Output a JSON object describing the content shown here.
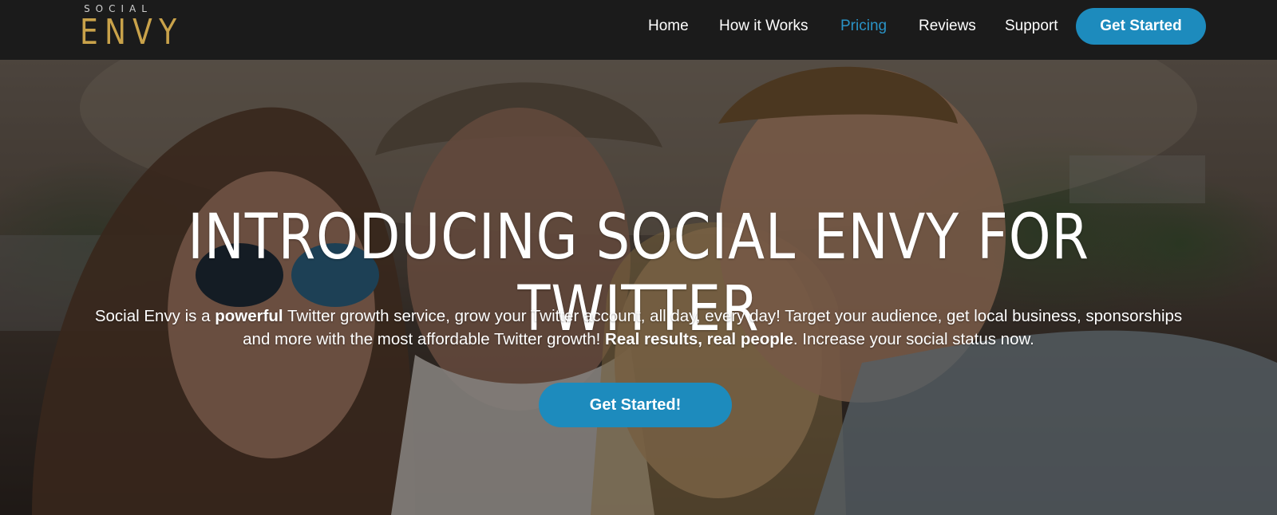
{
  "logo": {
    "small": "SOCIAL",
    "big": "ENVY"
  },
  "nav": {
    "items": [
      {
        "label": "Home"
      },
      {
        "label": "How it Works"
      },
      {
        "label": "Pricing",
        "active": true
      },
      {
        "label": "Reviews"
      },
      {
        "label": "Support"
      }
    ],
    "cta_label": "Get Started"
  },
  "hero": {
    "title": "INTRODUCING SOCIAL ENVY FOR TWITTER",
    "text": {
      "p1": "Social Envy is a ",
      "b1": "powerful",
      "p2": " Twitter growth service, grow your Twitter account, all day, every day! Target your audience, get local business, sponsorships and more with the most affordable Twitter growth! ",
      "b2": "Real results, real people",
      "p3": ". Increase your social status now."
    },
    "cta_label": "Get Started!"
  },
  "colors": {
    "topbar": "#1b1b1b",
    "logo_gold": "#c9a24a",
    "accent": "#1d8bbd",
    "active_link": "#2a93c6"
  }
}
